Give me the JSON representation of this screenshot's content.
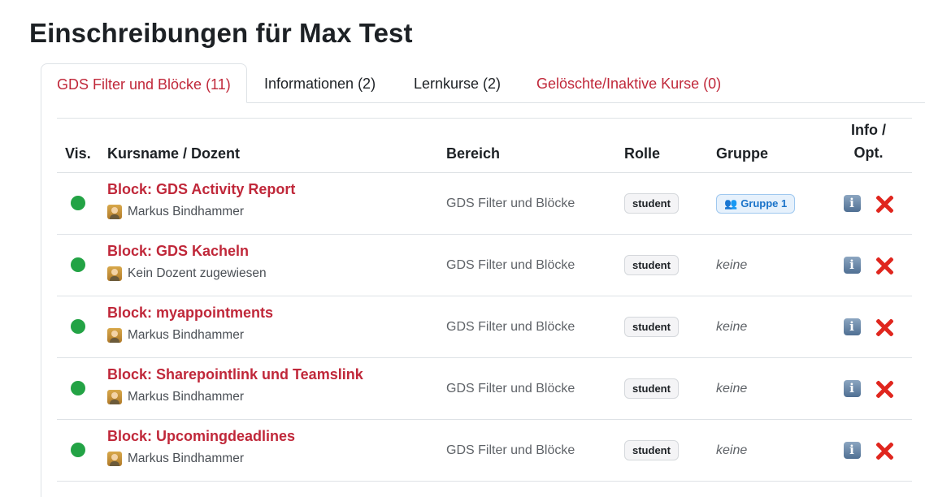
{
  "page": {
    "title": "Einschreibungen für Max Test"
  },
  "tabs": [
    {
      "label": "GDS Filter und Blöcke (11)",
      "active": true
    },
    {
      "label": "Informationen (2)",
      "active": false
    },
    {
      "label": "Lernkurse (2)",
      "active": false
    },
    {
      "label": "Gelöschte/Inaktive Kurse (0)",
      "active": false
    }
  ],
  "table": {
    "headers": {
      "vis": "Vis.",
      "course": "Kursname / Dozent",
      "area": "Bereich",
      "role": "Rolle",
      "group": "Gruppe",
      "info_line1": "Info /",
      "info_line2": "Opt."
    },
    "rows": [
      {
        "visible_color": "#23a345",
        "course": "Block: GDS Activity Report",
        "teacher": "Markus Bindhammer",
        "area": "GDS Filter und Blöcke",
        "role": "student",
        "group": "Gruppe 1",
        "has_group": true
      },
      {
        "visible_color": "#23a345",
        "course": "Block: GDS Kacheln",
        "teacher": "Kein Dozent zugewiesen",
        "area": "GDS Filter und Blöcke",
        "role": "student",
        "group": "keine",
        "has_group": false
      },
      {
        "visible_color": "#23a345",
        "course": "Block: myappointments",
        "teacher": "Markus Bindhammer",
        "area": "GDS Filter und Blöcke",
        "role": "student",
        "group": "keine",
        "has_group": false
      },
      {
        "visible_color": "#23a345",
        "course": "Block: Sharepointlink und Teamslink",
        "teacher": "Markus Bindhammer",
        "area": "GDS Filter und Blöcke",
        "role": "student",
        "group": "keine",
        "has_group": false
      },
      {
        "visible_color": "#23a345",
        "course": "Block: Upcomingdeadlines",
        "teacher": "Markus Bindhammer",
        "area": "GDS Filter und Blöcke",
        "role": "student",
        "group": "keine",
        "has_group": false
      }
    ]
  },
  "icons": {
    "visibility": "status-dot-icon",
    "teacher": "teacher-avatar-icon",
    "group": "people-icon",
    "info": "info-icon",
    "delete": "delete-x-icon"
  },
  "colors": {
    "accent_red": "#c0283a",
    "visible_green": "#23a345",
    "delete_red": "#e0261e",
    "group_blue": "#1a73c9"
  }
}
